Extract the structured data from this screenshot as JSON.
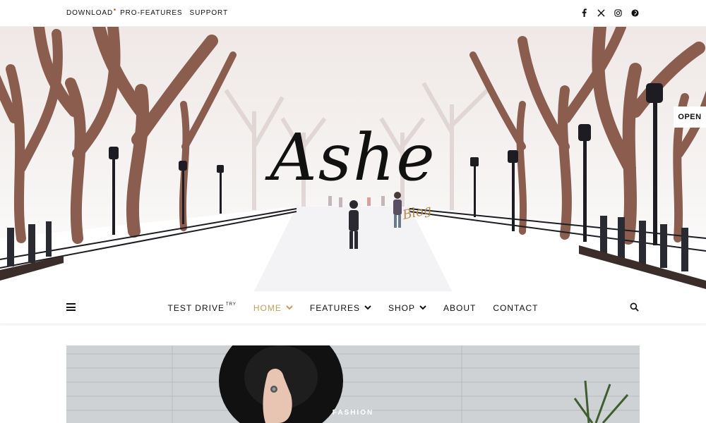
{
  "topbar": {
    "links": [
      {
        "label": "DOWNLOAD",
        "has_badge": true
      },
      {
        "label": "PRO-FEATURES"
      },
      {
        "label": "SUPPORT"
      }
    ],
    "social_icons": [
      "facebook-icon",
      "x-icon",
      "instagram-icon",
      "pinterest-icon"
    ]
  },
  "hero": {
    "logo_title": "Ashe",
    "logo_subtitle": "Blog",
    "open_label": "OPEN"
  },
  "nav": {
    "items": [
      {
        "label": "TEST DRIVE",
        "sup": "TRY",
        "active": false,
        "dropdown": false
      },
      {
        "label": "HOME",
        "active": true,
        "dropdown": true
      },
      {
        "label": "FEATURES",
        "active": false,
        "dropdown": true
      },
      {
        "label": "SHOP",
        "active": false,
        "dropdown": true
      },
      {
        "label": "ABOUT",
        "active": false,
        "dropdown": false
      },
      {
        "label": "CONTACT",
        "active": false,
        "dropdown": false
      }
    ],
    "accent_color": "#c19f5e"
  },
  "featured": {
    "category": "FASHION"
  },
  "colors": {
    "badge": "#e14a1f",
    "accent": "#c19f5e",
    "text": "#111111"
  }
}
